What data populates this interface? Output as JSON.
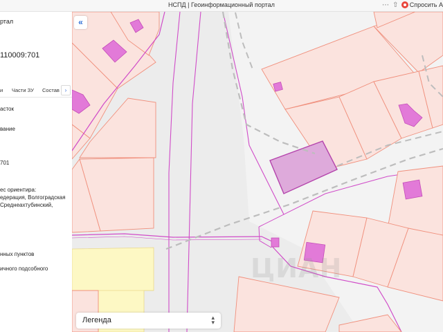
{
  "browser": {
    "title": "НСПД | Геоинформационный портал",
    "ask_label": "Спросить А"
  },
  "panel": {
    "portal_fragment": "ртал",
    "cadastral_fragment": "110009:701",
    "tabs": [
      "и",
      "Части ЗУ",
      "Состав"
    ],
    "next_tab_label": "›",
    "lines": {
      "type": "асток",
      "name": "вание",
      "number": "701",
      "address_label": "ес ориентира:",
      "address_1": "едерация, Волгоградская",
      "address_2": "Среднеахтубинский,",
      "category": "нных пунктов",
      "use": "ичного подсобного"
    }
  },
  "map": {
    "collapse_label": "«",
    "legend_label": "Легенда",
    "watermark": "ЦИАН",
    "colors": {
      "background": "#ececec",
      "parcel_fill": "#fbe3de",
      "parcel_stroke": "#f08f7c",
      "building_fill": "#e27ad8",
      "building_stroke": "#c44cb8",
      "selected_fill": "#deaadb",
      "selected_stroke": "#b444ac",
      "road_line": "#d04bc8",
      "zone_fill": "#fdf8c4",
      "dashed_line": "#bdbdbd"
    }
  }
}
